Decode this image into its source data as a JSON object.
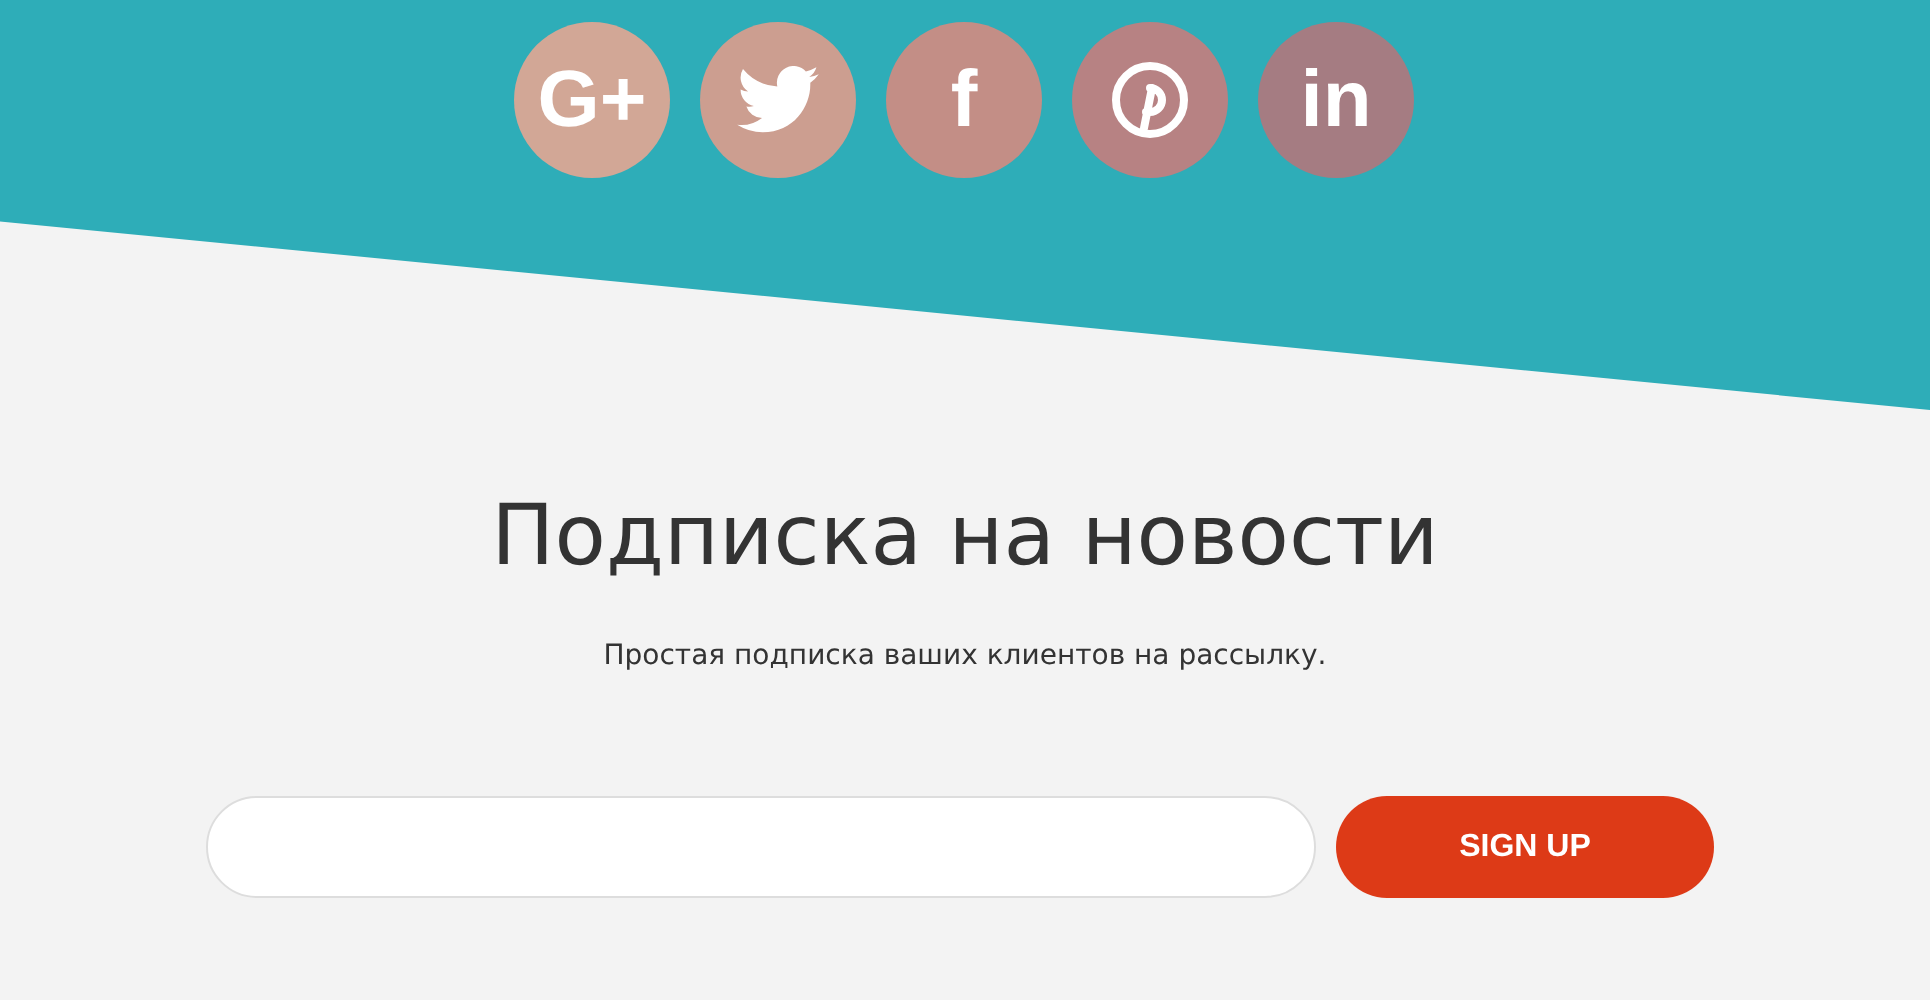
{
  "social_links": [
    {
      "kind": "text",
      "text": "G+",
      "color": "#d2a796"
    },
    {
      "kind": "bird",
      "color": "#cc9e90"
    },
    {
      "kind": "text",
      "text": "f",
      "color": "#c38e86"
    },
    {
      "kind": "pin",
      "color": "#b78283"
    },
    {
      "kind": "text",
      "text": "in",
      "color": "#a57c82"
    }
  ],
  "title": "Подписка на новости",
  "subtitle": "Простая подписка ваших клиентов на рассылку.",
  "button": "SIGN UP"
}
